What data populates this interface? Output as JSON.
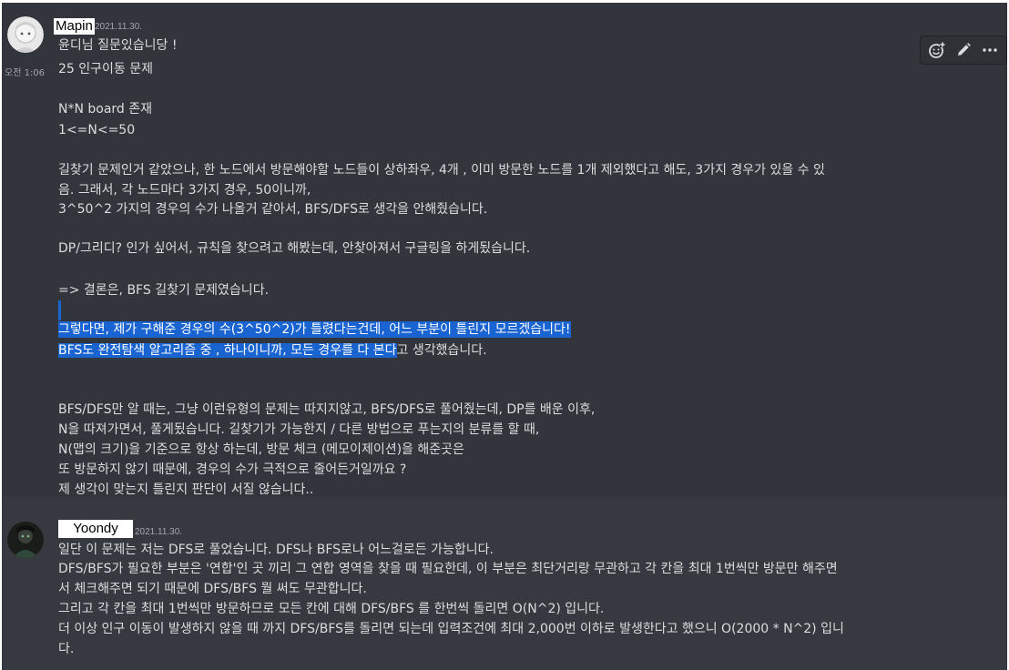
{
  "messages": [
    {
      "username": "Mapin",
      "timestamp": "2021.11.30.",
      "side_time": "오전 1:06",
      "lines": [
        "윤디님 질문있습니당 !",
        "25 인구이동 문제",
        "N*N board  존재",
        "1<=N<=50",
        "길찾기 문제인거 같았으나, 한 노드에서 방문해야할 노드들이 상하좌우, 4개 ,  이미 방문한 노드를 1개 제외했다고 해도, 3가지 경우가 있을 수 있",
        "음. 그래서, 각 노드마다 3가지 경우, 50이니까,",
        "3^50^2 가지의 경우의 수가 나올거 같아서, BFS/DFS로 생각을 안해줬습니다.",
        "DP/그리디? 인가 싶어서, 규칙을 찾으려고 해봤는데, 안찾아져서 구글링을 하게됬습니다.",
        "=> 결론은, BFS 길찾기 문제였습니다.",
        "그렇다면, 제가 구해준 경우의 수(3^50^2)가 틀렸다는건데, 어느 부분이 틀린지 모르겠습니다!",
        "BFS도 완전탐색 알고리즘 중 , 하나이니까, 모든 경우를 다 본다",
        "고 생각했습니다.",
        "BFS/DFS만 알 때는, 그냥 이런유형의 문제는 따지지않고, BFS/DFS로 풀어줬는데, DP를 배운 이후,",
        "N을 따져가면서, 풀게됬습니다. 길찾기가 가능한지 / 다른 방법으로 푸는지의 분류를 할 때,",
        "N(맵의 크기)을 기준으로 항상 하는데, 방문 체크 (메모이제이션)을 해준곳은",
        "또 방문하지 않기 때문에, 경우의 수가 극적으로 줄어든거일까요 ?",
        "제 생각이 맞는지 틀린지 판단이 서질 않습니다.."
      ]
    },
    {
      "username": "Yoondy",
      "timestamp": "2021.11.30.",
      "lines": [
        "일단 이 문제는 저는 DFS로 풀었습니다. DFS나 BFS로나 어느걸로든 가능합니다.",
        "DFS/BFS가 필요한 부분은 '연합'인 곳 끼리 그 연합 영역을 찾을 때 필요한데, 이 부분은 최단거리랑 무관하고 각 칸을 최대 1번씩만 방문만 해주면",
        "서 체크해주면 되기 때문에 DFS/BFS 뭘 써도 무관합니다.",
        "그리고 각 칸을 최대 1번씩만 방문하므로 모든 칸에 대해 DFS/BFS 를 한번씩 돌리면 O(N^2) 입니다.",
        "더 이상 인구 이동이 발생하지 않을 때 까지 DFS/BFS를 돌리면 되는데 입력조건에 최대 2,000번 이하로 발생한다고 했으니 O(2000 * N^2) 입니",
        "다."
      ]
    }
  ],
  "toolbar": {
    "icons": [
      "add-reaction-icon",
      "edit-icon",
      "more-icon"
    ]
  },
  "colors": {
    "background": "#36393f",
    "hover_background": "#32353b",
    "text": "#dcddde",
    "selection": "#1a64d2"
  }
}
